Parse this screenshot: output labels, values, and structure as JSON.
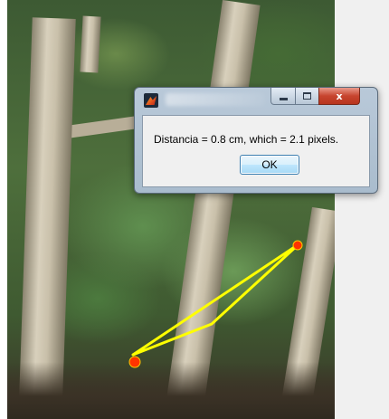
{
  "dialog": {
    "message": "Distancia = 0.8 cm, which = 2.1 pixels.",
    "ok_label": "OK",
    "close_glyph": "x",
    "icon": "matlab-icon"
  },
  "measurement": {
    "line_color": "#ffff00",
    "endpoint_color": "#ff3300"
  }
}
